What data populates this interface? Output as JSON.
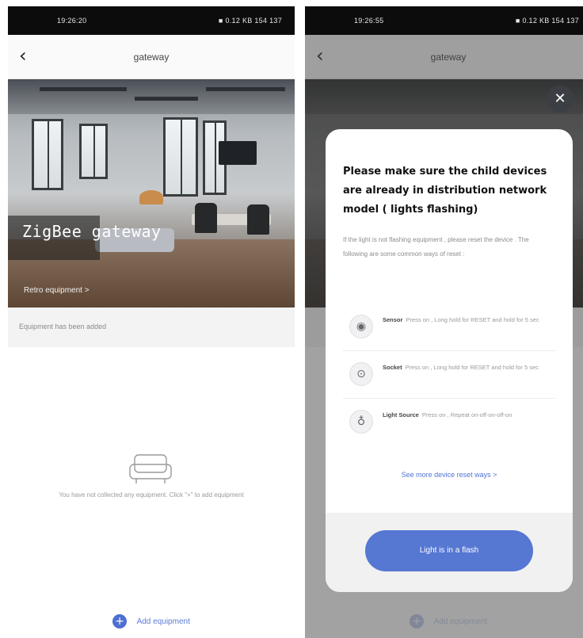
{
  "status_bar": {
    "time": "19:26:20",
    "right_text": "■ 0.12 KB  154 137"
  },
  "status_bar_right": {
    "time": "19:26:55",
    "right_text": "■ 0.12 KB  154 137"
  },
  "nav": {
    "back_icon": "chevron-left-icon",
    "title": "gateway"
  },
  "hero": {
    "title": "ZigBee gateway",
    "link": "Retro equipment >"
  },
  "info_strip": {
    "text": "Equipment has been added"
  },
  "empty_state": {
    "icon": "sofa-icon",
    "text": "You have not collected any equipment. Click \"+\" to add equipment"
  },
  "add_button": {
    "icon": "plus-icon",
    "label": "Add equipment"
  },
  "modal": {
    "title": "Please make sure the child devices are already in distribution network model ( lights flashing)",
    "description": "If the light is not flashing equipment , please reset the device . The following are some common ways of reset :",
    "devices": [
      {
        "icon": "sensor-icon",
        "name": "Sensor",
        "text": "Press on , Long hold for RESET and hold for 5 sec"
      },
      {
        "icon": "socket-icon",
        "name": "Socket",
        "text": "Press on , Long hold for RESET and hold for 5 sec"
      },
      {
        "icon": "bulb-icon",
        "name": "Light Source",
        "text": "Press on , Repeat on-off-on-off-on"
      }
    ],
    "more_link": "See more device reset ways >",
    "button": "Light is in a flash"
  },
  "close_icon": "close-icon",
  "colors": {
    "accent": "#5677d2",
    "link": "#4f74d4",
    "status_bar": "#0c0c0c"
  }
}
